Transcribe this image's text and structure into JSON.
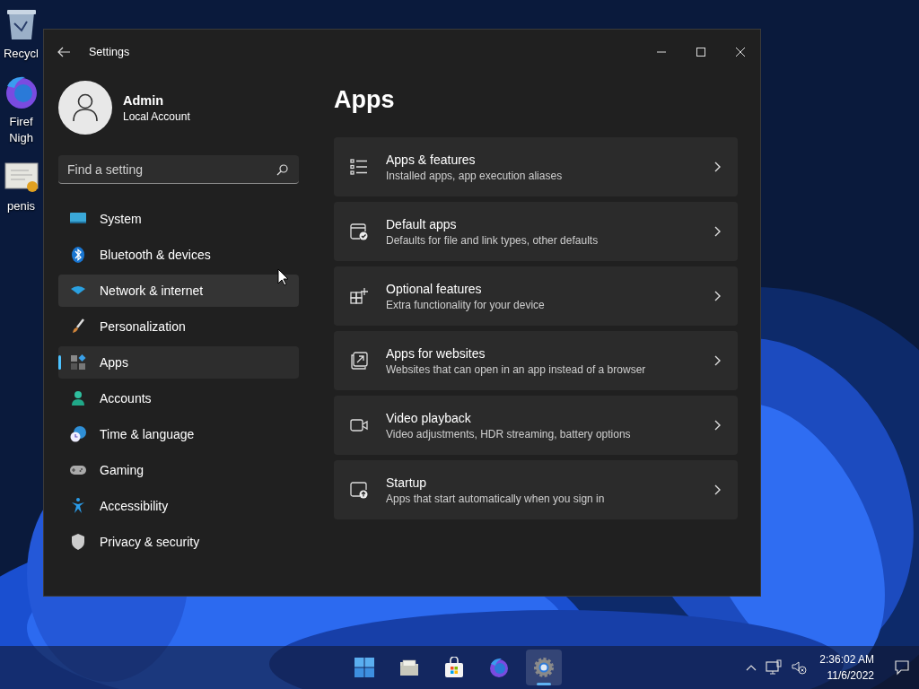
{
  "desktop_icons": [
    {
      "label_lines": [
        "Recycl"
      ]
    },
    {
      "label_lines": [
        "Firef",
        "Nigh"
      ]
    },
    {
      "label_lines": [
        "penis"
      ]
    }
  ],
  "window": {
    "title": "Settings"
  },
  "profile": {
    "name": "Admin",
    "account": "Local Account"
  },
  "search": {
    "placeholder": "Find a setting"
  },
  "sidebar": {
    "items": [
      {
        "label": "System",
        "selected": false,
        "hovered": false
      },
      {
        "label": "Bluetooth & devices",
        "selected": false,
        "hovered": false
      },
      {
        "label": "Network & internet",
        "selected": false,
        "hovered": true
      },
      {
        "label": "Personalization",
        "selected": false,
        "hovered": false
      },
      {
        "label": "Apps",
        "selected": true,
        "hovered": false
      },
      {
        "label": "Accounts",
        "selected": false,
        "hovered": false
      },
      {
        "label": "Time & language",
        "selected": false,
        "hovered": false
      },
      {
        "label": "Gaming",
        "selected": false,
        "hovered": false
      },
      {
        "label": "Accessibility",
        "selected": false,
        "hovered": false
      },
      {
        "label": "Privacy & security",
        "selected": false,
        "hovered": false
      }
    ]
  },
  "page": {
    "title": "Apps",
    "cards": [
      {
        "title": "Apps & features",
        "subtitle": "Installed apps, app execution aliases"
      },
      {
        "title": "Default apps",
        "subtitle": "Defaults for file and link types, other defaults"
      },
      {
        "title": "Optional features",
        "subtitle": "Extra functionality for your device"
      },
      {
        "title": "Apps for websites",
        "subtitle": "Websites that can open in an app instead of a browser"
      },
      {
        "title": "Video playback",
        "subtitle": "Video adjustments, HDR streaming, battery options"
      },
      {
        "title": "Startup",
        "subtitle": "Apps that start automatically when you sign in"
      }
    ]
  },
  "taskbar": {
    "apps": [
      {
        "active": false
      },
      {
        "active": false
      },
      {
        "active": false
      },
      {
        "active": false
      },
      {
        "active": true
      }
    ],
    "time": "2:36:02 AM",
    "date": "11/6/2022"
  }
}
